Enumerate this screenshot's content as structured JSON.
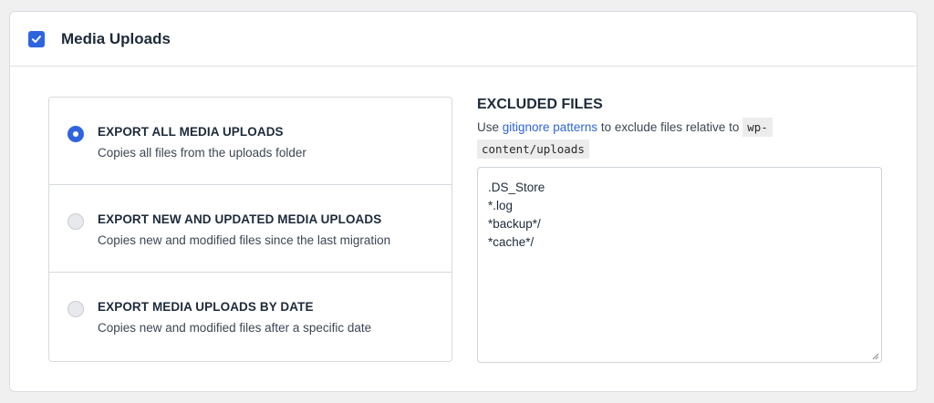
{
  "header": {
    "title": "Media Uploads",
    "checked": true
  },
  "options": [
    {
      "title": "EXPORT ALL MEDIA UPLOADS",
      "desc": "Copies all files from the uploads folder",
      "selected": true
    },
    {
      "title": "EXPORT NEW AND UPDATED MEDIA UPLOADS",
      "desc": "Copies new and modified files since the last migration",
      "selected": false
    },
    {
      "title": "EXPORT MEDIA UPLOADS BY DATE",
      "desc": "Copies new and modified files after a specific date",
      "selected": false
    }
  ],
  "excluded": {
    "title": "EXCLUDED FILES",
    "desc_prefix": "Use ",
    "link_text": "gitignore patterns",
    "desc_middle": " to exclude files relative to ",
    "code_line1": "wp-",
    "code_line2": "content/uploads",
    "patterns": ".DS_Store\n*.log\n*backup*/\n*cache*/"
  },
  "colors": {
    "accent": "#2f64e0",
    "text": "#1d2a3a"
  }
}
